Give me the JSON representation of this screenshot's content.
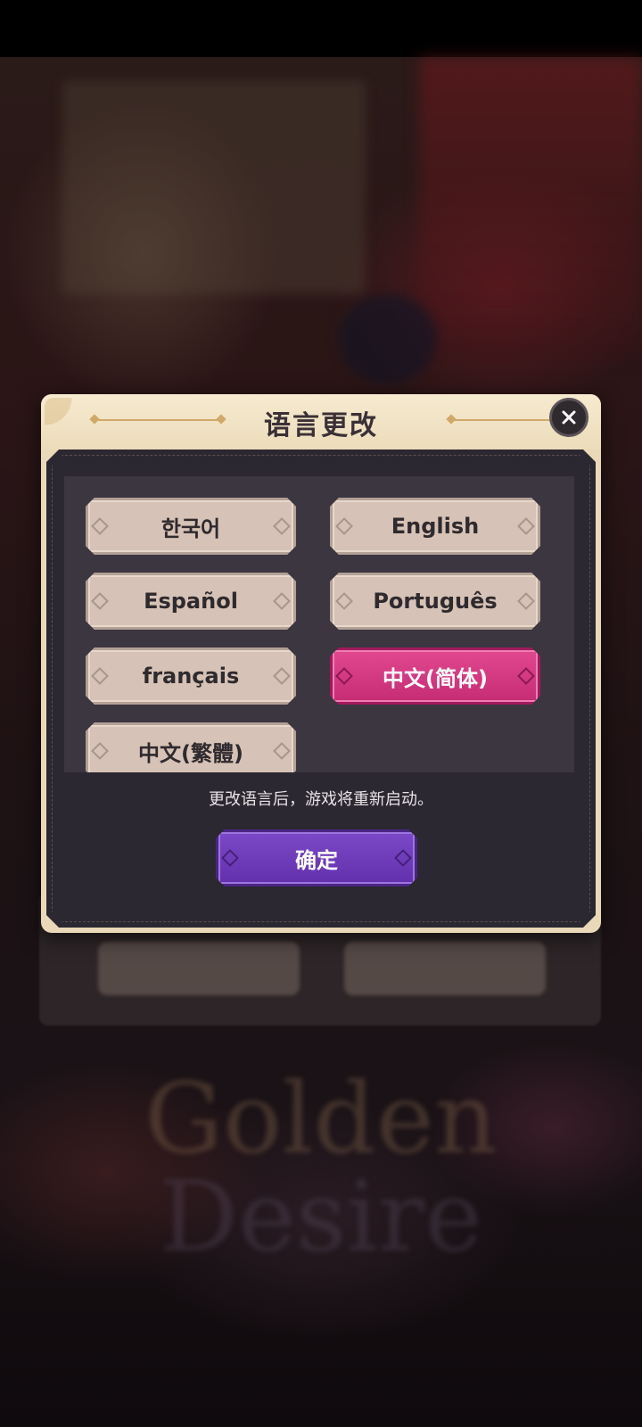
{
  "dialog": {
    "title": "语言更改",
    "close_icon": "close-icon",
    "languages": [
      {
        "label": "한국어",
        "selected": false
      },
      {
        "label": "English",
        "selected": false
      },
      {
        "label": "Español",
        "selected": false
      },
      {
        "label": "Português",
        "selected": false
      },
      {
        "label": "français",
        "selected": false
      },
      {
        "label": "中文(简体)",
        "selected": true
      },
      {
        "label": "中文(繁體)",
        "selected": false
      }
    ],
    "note": "更改语言后，游戏将重新启动。",
    "confirm_label": "确定"
  },
  "background": {
    "logo_line1": "Golden",
    "logo_line2": "Desire"
  },
  "colors": {
    "selected_accent": "#d63a82",
    "confirm_accent": "#6f3cba",
    "dialog_body": "#2c2831",
    "dialog_header": "#f1e3c6"
  }
}
